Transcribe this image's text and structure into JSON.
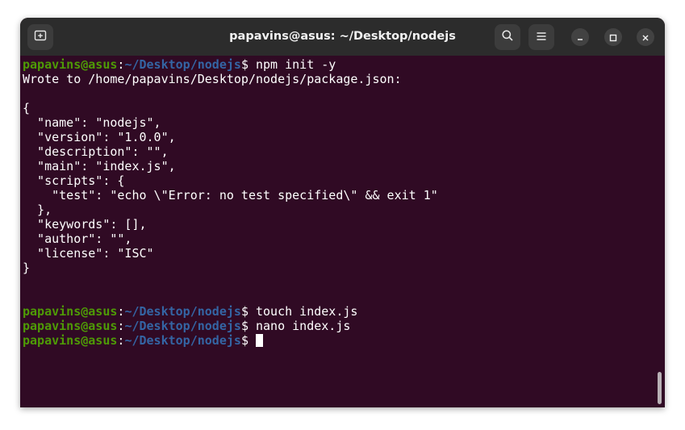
{
  "window": {
    "title": "papavins@asus: ~/Desktop/nodejs"
  },
  "icons": {
    "new_tab": "new-tab-icon",
    "search": "search-icon",
    "menu": "hamburger-menu-icon",
    "minimize": "minimize-icon",
    "maximize": "maximize-icon",
    "close": "close-icon"
  },
  "colors": {
    "background": "#300a24",
    "user": "#4e9a06",
    "path": "#3465a4",
    "text": "#ffffff",
    "titlebar": "#2c2c2c"
  },
  "terminal": {
    "prompt_user": "papavins@asus",
    "prompt_sep": ":",
    "prompt_path": "~/Desktop/nodejs",
    "prompt_end": "$ ",
    "lines": [
      {
        "type": "prompt",
        "cmd": "npm init -y"
      },
      {
        "type": "text",
        "text": "Wrote to /home/papavins/Desktop/nodejs/package.json:"
      },
      {
        "type": "text",
        "text": ""
      },
      {
        "type": "text",
        "text": "{"
      },
      {
        "type": "text",
        "text": "  \"name\": \"nodejs\","
      },
      {
        "type": "text",
        "text": "  \"version\": \"1.0.0\","
      },
      {
        "type": "text",
        "text": "  \"description\": \"\","
      },
      {
        "type": "text",
        "text": "  \"main\": \"index.js\","
      },
      {
        "type": "text",
        "text": "  \"scripts\": {"
      },
      {
        "type": "text",
        "text": "    \"test\": \"echo \\\"Error: no test specified\\\" && exit 1\""
      },
      {
        "type": "text",
        "text": "  },"
      },
      {
        "type": "text",
        "text": "  \"keywords\": [],"
      },
      {
        "type": "text",
        "text": "  \"author\": \"\","
      },
      {
        "type": "text",
        "text": "  \"license\": \"ISC\""
      },
      {
        "type": "text",
        "text": "}"
      },
      {
        "type": "text",
        "text": ""
      },
      {
        "type": "text",
        "text": ""
      },
      {
        "type": "prompt",
        "cmd": "touch index.js"
      },
      {
        "type": "prompt",
        "cmd": "nano index.js"
      },
      {
        "type": "prompt",
        "cmd": "",
        "cursor": true
      }
    ]
  }
}
